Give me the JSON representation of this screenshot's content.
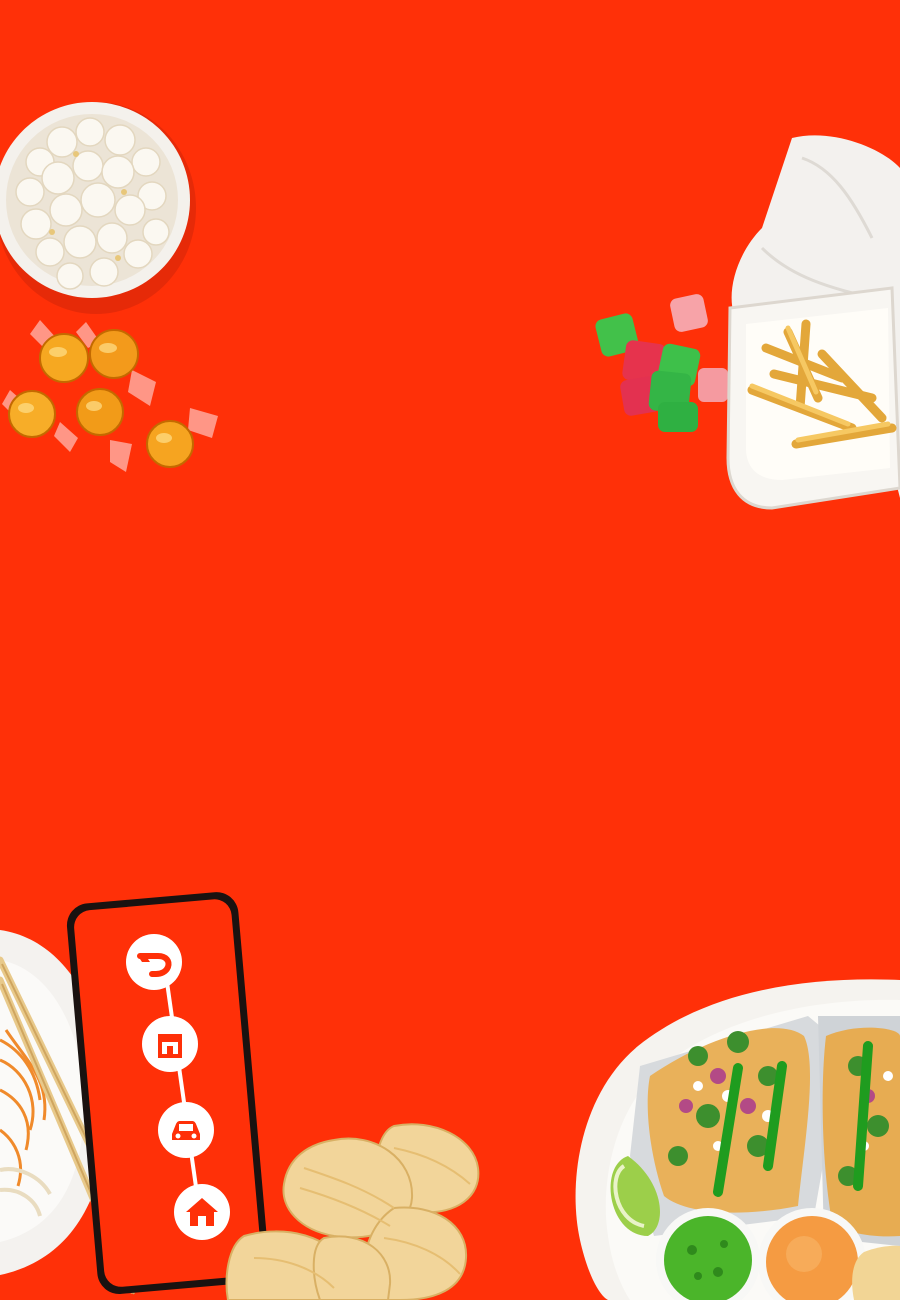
{
  "background_color": "#ff3008",
  "phone": {
    "screen_color": "#ff3008",
    "steps": [
      {
        "icon": "doordash-logo-icon"
      },
      {
        "icon": "store-icon"
      },
      {
        "icon": "car-icon"
      },
      {
        "icon": "home-icon"
      }
    ]
  },
  "food_items": [
    "popcorn-bowl",
    "wrapped-hard-candies",
    "gummy-candies",
    "french-fries-container",
    "noodle-plate-with-chopsticks",
    "potato-chips",
    "tacos-plate-with-salsas"
  ]
}
